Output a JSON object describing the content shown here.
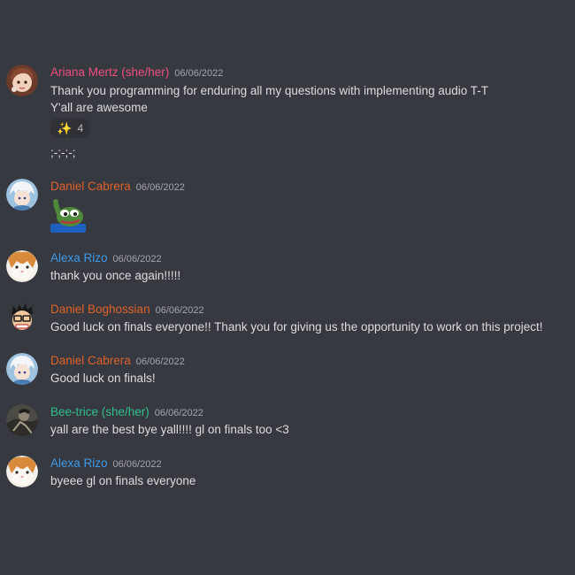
{
  "colors": {
    "background": "#36393f",
    "ariana": "#f04f7e",
    "daniel_cabrera": "#e0612b",
    "alexa": "#3e9be9",
    "daniel_boghossian": "#e0612b",
    "bee_trice": "#2fbf8e"
  },
  "messages": [
    {
      "author": "Ariana Mertz (she/her)",
      "timestamp": "06/06/2022",
      "avatar_icon": "anime-girl-avatar-icon",
      "lines": [
        "Thank you programming for enduring all my questions with implementing audio T-T",
        "Y'all are awesome"
      ],
      "reaction": {
        "emoji": "✨",
        "emoji_name": "sparkles-icon",
        "count": "4"
      },
      "extra_line": ";-;-;-;"
    },
    {
      "author": "Daniel Cabrera",
      "timestamp": "06/06/2022",
      "avatar_icon": "white-haired-avatar-icon",
      "sticker": "pepe-wave-sticker"
    },
    {
      "author": "Alexa Rizo",
      "timestamp": "06/06/2022",
      "avatar_icon": "hamster-avatar-icon",
      "lines": [
        "thank you once again!!!!!"
      ]
    },
    {
      "author": "Daniel Boghossian",
      "timestamp": "06/06/2022",
      "avatar_icon": "glasses-character-avatar-icon",
      "lines": [
        "Good luck on finals everyone!! Thank you for giving us the opportunity to work on this project!"
      ]
    },
    {
      "author": "Daniel Cabrera",
      "timestamp": "06/06/2022",
      "avatar_icon": "white-haired-avatar-icon",
      "lines": [
        "Good luck on finals!"
      ]
    },
    {
      "author": "Bee-trice (she/her)",
      "timestamp": "06/06/2022",
      "avatar_icon": "dark-character-avatar-icon",
      "lines": [
        "yall are the best bye yall!!!! gl on finals too <3"
      ]
    },
    {
      "author": "Alexa Rizo",
      "timestamp": "06/06/2022",
      "avatar_icon": "hamster-avatar-icon",
      "lines": [
        "byeee gl on finals everyone"
      ]
    }
  ]
}
